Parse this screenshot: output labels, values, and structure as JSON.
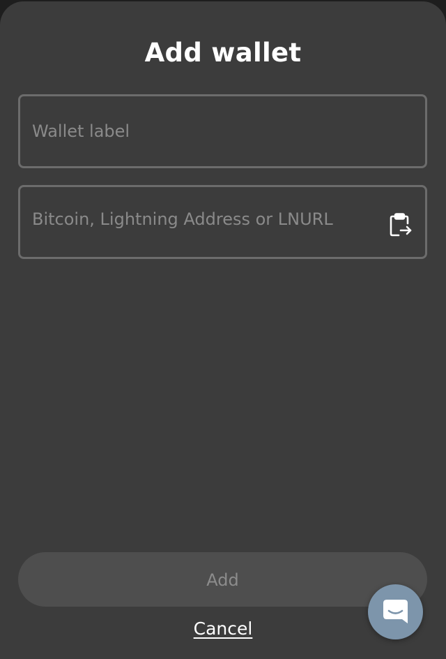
{
  "dialog": {
    "title": "Add wallet"
  },
  "form": {
    "label_placeholder": "Wallet label",
    "address_placeholder": "Bitcoin, Lightning Address or LNURL"
  },
  "actions": {
    "add_label": "Add",
    "cancel_label": "Cancel"
  },
  "icons": {
    "paste": "clipboard-paste-icon",
    "chat": "chat-bubble-icon"
  },
  "colors": {
    "sheet_background": "#3c3c3c",
    "field_border": "#6c6c6c",
    "add_button_disabled": "#4e4e4e",
    "chat_button": "#7d95ab"
  }
}
